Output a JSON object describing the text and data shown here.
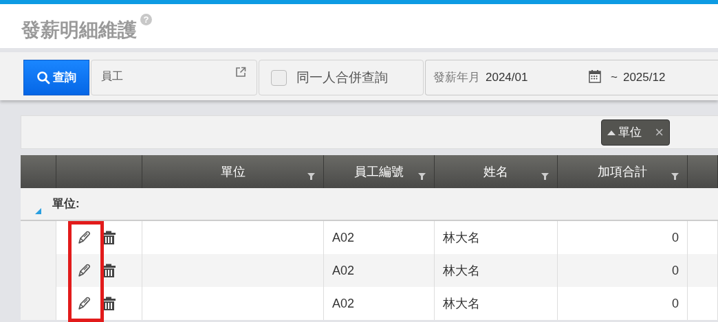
{
  "page": {
    "title": "發薪明細維護",
    "help": "?"
  },
  "toolbar": {
    "search_button": "查詢",
    "employee_field": {
      "placeholder": "員工"
    },
    "merge_checkbox": {
      "label": "同一人合併查詢",
      "checked": false
    },
    "pay_period": {
      "label": "發薪年月",
      "from": "2024/01",
      "separator": "~",
      "to": "2025/12"
    }
  },
  "group_chips": [
    {
      "label": "單位",
      "ascending": true,
      "close": "×"
    }
  ],
  "table": {
    "columns": [
      {
        "filter": false
      },
      {
        "filter": false
      },
      {
        "label": "單位",
        "filter": true
      },
      {
        "label": "員工編號",
        "filter": true
      },
      {
        "label": "姓名",
        "filter": true
      },
      {
        "label": "加項合計",
        "filter": true
      },
      {
        "filter": false
      }
    ],
    "group": {
      "label": "單位:",
      "expanded": true
    },
    "edit_highlight": true,
    "rows": [
      {
        "employee_id": "A02",
        "name": "林大名",
        "additions_total": "0"
      },
      {
        "employee_id": "A02",
        "name": "林大名",
        "additions_total": "0"
      },
      {
        "employee_id": "A02",
        "name": "林大名",
        "additions_total": "0"
      }
    ]
  }
}
